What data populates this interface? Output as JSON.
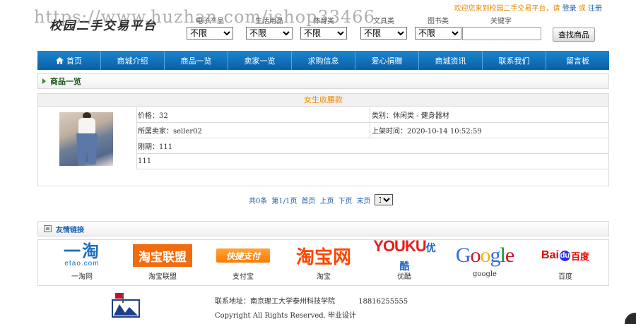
{
  "header": {
    "watermark": "https://www.huzhan.com/ishop33466",
    "logo_text": "校园二手交易平台",
    "welcome_text": "欢迎您来到校园二手交易平台，请",
    "login_link": "登录",
    "or_text": "或",
    "register_link": "注册"
  },
  "search": {
    "filters": [
      {
        "label": "电子产品",
        "value": "不限"
      },
      {
        "label": "生活用品",
        "value": "不限"
      },
      {
        "label": "体育类",
        "value": "不限"
      },
      {
        "label": "文具类",
        "value": "不限"
      },
      {
        "label": "图书类",
        "value": "不限"
      }
    ],
    "keyword_label": "关键字",
    "keyword_value": "",
    "button_label": "查找商品"
  },
  "nav": {
    "items": [
      {
        "label": "首页",
        "icon": "home-icon"
      },
      {
        "label": "商城介绍"
      },
      {
        "label": "商品一览"
      },
      {
        "label": "卖家一览"
      },
      {
        "label": "求购信息"
      },
      {
        "label": "爱心捐赠"
      },
      {
        "label": "商城资讯"
      },
      {
        "label": "联系我们"
      },
      {
        "label": "留言板"
      }
    ]
  },
  "section": {
    "title": "商品一览"
  },
  "product": {
    "name": "女生收腰款",
    "price": "价格：32",
    "category": "类别：休闲类 - 健身器材",
    "seller": "所属卖家：seller02",
    "listed_time": "上架时间：2020-10-14 10:52:59",
    "period": "刚期：111",
    "description": "111"
  },
  "pagination": {
    "total": "共0条",
    "page_info": "第1/1页",
    "first": "首页",
    "prev": "上页",
    "next": "下页",
    "last": "末页",
    "current": "1"
  },
  "links": {
    "title": "友情链接",
    "items": [
      {
        "label": "一淘网",
        "logo_text": "一淘",
        "logo_sub": "etao.com"
      },
      {
        "label": "淘宝联盟",
        "logo_text": "淘宝联盟"
      },
      {
        "label": "支付宝",
        "logo_text": "快捷支付"
      },
      {
        "label": "淘宝",
        "logo_text": "淘宝网"
      },
      {
        "label": "优酷",
        "logo_text": "YOUKU",
        "logo_sub": "优酷"
      },
      {
        "label": "google",
        "logo_text": "Google"
      },
      {
        "label": "百度",
        "logo_text": "Bai",
        "logo_du": "du",
        "logo_sub": "百度"
      }
    ]
  },
  "footer": {
    "address": "联系地址：南京理工大学泰州科技学院",
    "phone": "18816255555",
    "copyright": "Copyright All Rights Reserved. 毕业设计"
  },
  "colors": {
    "nav_blue": "#0a5fa5",
    "accent_orange": "#f08c00",
    "link_blue": "#1c5fae"
  }
}
